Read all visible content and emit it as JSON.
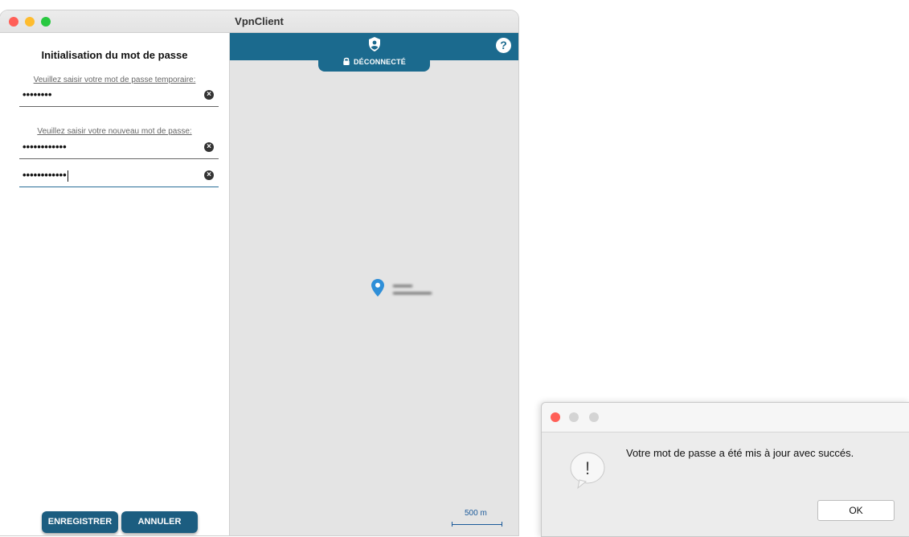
{
  "window": {
    "title": "VpnClient"
  },
  "form": {
    "title": "Initialisation du mot de passe",
    "temp_label": "Veuillez saisir votre mot de passe temporaire:",
    "temp_value": "••••••••",
    "new_label": "Veuillez saisir votre nouveau mot de passe:",
    "new_value": "••••••••••••",
    "confirm_value": "••••••••••••",
    "clear_symbol": "×",
    "save_label": "ENREGISTRER",
    "cancel_label": "ANNULER"
  },
  "map": {
    "status_label": "DÉCONNECTÉ",
    "help_symbol": "?",
    "scale_label": "500 m",
    "accent_color": "#1b6a8e"
  },
  "dialog": {
    "message": "Votre mot de passe a été mis à jour avec succés.",
    "ok_label": "OK",
    "alert_symbol": "!"
  }
}
